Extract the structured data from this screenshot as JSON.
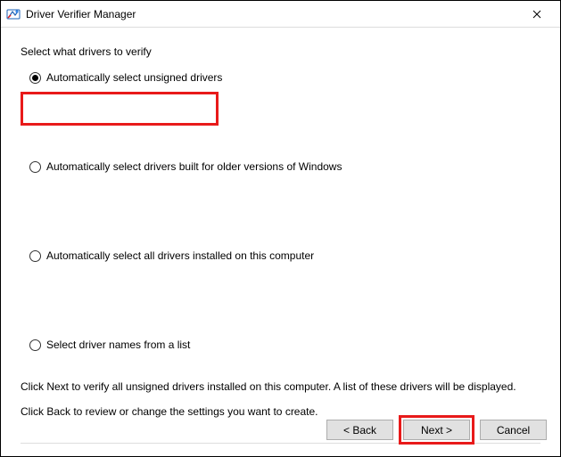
{
  "window": {
    "title": "Driver Verifier Manager"
  },
  "section_label": "Select what drivers to verify",
  "options": {
    "opt1": "Automatically select unsigned drivers",
    "opt2": "Automatically select drivers built for older versions of Windows",
    "opt3": "Automatically select all drivers installed on this computer",
    "opt4": "Select driver names from a list",
    "selected": "opt1"
  },
  "info": {
    "line1": "Click Next to verify all unsigned drivers installed on this computer. A list of these drivers will be displayed.",
    "line2": "Click Back to review or change the settings you want to create."
  },
  "buttons": {
    "back": "< Back",
    "next": "Next >",
    "cancel": "Cancel"
  },
  "highlight": {
    "option": "opt1",
    "button": "next",
    "color": "#e81a1a"
  }
}
